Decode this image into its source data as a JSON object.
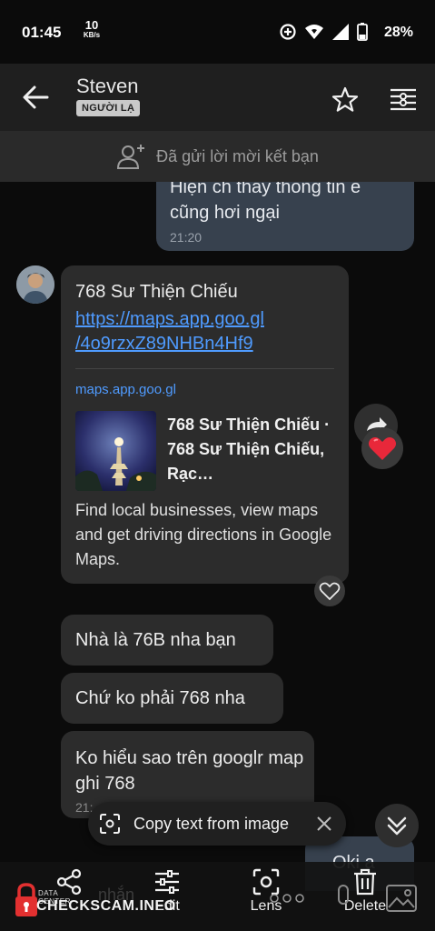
{
  "status_bar": {
    "time": "01:45",
    "speed_value": "10",
    "speed_unit": "KB/s",
    "battery": "28%"
  },
  "header": {
    "contact_name": "Steven",
    "badge": "NGƯỜI LẠ"
  },
  "friend_request_banner": {
    "text": "Đã gửi lời mời kết bạn"
  },
  "messages": {
    "outgoing_top": {
      "text": "Hiện ch thấy thông tin e\ncũng hơi ngại",
      "time": "21:20"
    },
    "link_message": {
      "title": "768 Sư Thiện Chiếu",
      "url": "https://maps.app.goo.gl\n/4o9rzxZ89NHBn4Hf9",
      "preview_domain": "maps.app.goo.gl",
      "preview_title": "768 Sư Thiện Chiếu · 768 Sư Thiện Chiếu, Rạc…",
      "preview_description": "Find local businesses, view maps and get driving directions in Google Maps."
    },
    "msg_1": "Nhà là 76B nha bạn",
    "msg_2": "Chứ ko phải 768 nha",
    "msg_3": {
      "text": "Ko hiểu sao trên googlr map ghi 768",
      "time": "21:"
    },
    "outgoing_bottom": "Oki a"
  },
  "copy_text_pill": {
    "label": "Copy text from image"
  },
  "toolbar": {
    "share": "",
    "edit": "Edit",
    "lens": "Lens",
    "delete": "Delete"
  },
  "watermark": {
    "top": "DATA CENTER",
    "main": "CHECKSCAM.INFO",
    "ghost": "nhắn"
  },
  "colors": {
    "link": "#4f9bff",
    "outgoing_bubble": "#37414e",
    "incoming_bubble": "#2c2c2c",
    "heart": "#e8283a"
  }
}
